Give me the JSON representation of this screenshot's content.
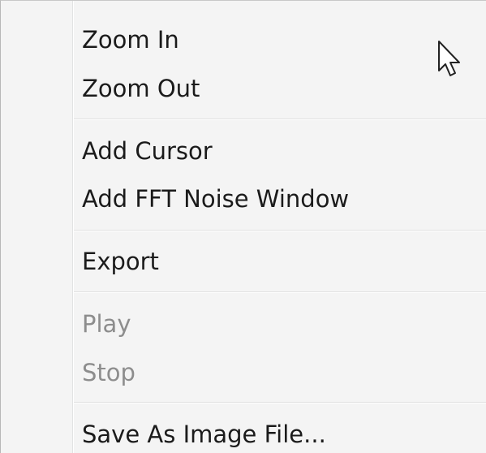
{
  "menu": {
    "items": [
      {
        "label": "Zoom In",
        "state": "highlighted"
      },
      {
        "label": "Zoom Out",
        "state": "enabled"
      },
      {
        "label": "Add Cursor",
        "state": "enabled"
      },
      {
        "label": "Add FFT Noise Window",
        "state": "enabled"
      },
      {
        "label": "Export",
        "state": "enabled"
      },
      {
        "label": "Play",
        "state": "disabled"
      },
      {
        "label": "Stop",
        "state": "disabled"
      },
      {
        "label": "Save As Image File...",
        "state": "enabled"
      }
    ]
  },
  "colors": {
    "menu_background": "#f4f4f4",
    "highlight_border": "#a8d0f0",
    "highlight_fill": "#dcecfb",
    "text": "#1b1b1b",
    "disabled_text": "#8d8d8d"
  },
  "icons": {
    "pointer": "mouse-pointer-icon"
  }
}
